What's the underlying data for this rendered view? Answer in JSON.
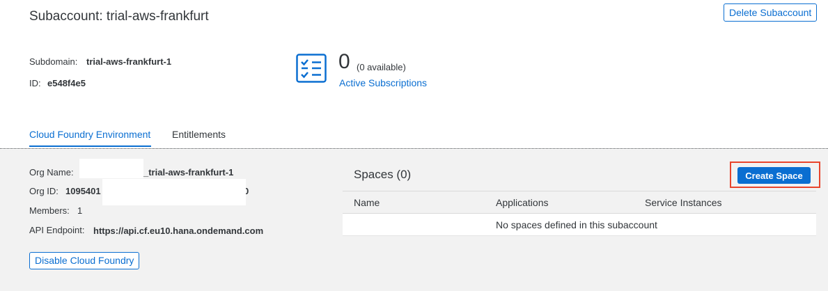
{
  "header": {
    "title": "Subaccount: trial-aws-frankfurt",
    "delete_label": "Delete Subaccount"
  },
  "info": {
    "subdomain_label": "Subdomain:",
    "subdomain_value": "trial-aws-frankfurt-1",
    "id_label": "ID:",
    "id_value": "e548f4e5"
  },
  "subscriptions": {
    "icon": "checklist-icon",
    "count": "0",
    "available": "(0 available)",
    "link_label": "Active Subscriptions"
  },
  "tabs": [
    {
      "label": "Cloud Foundry Environment",
      "active": true
    },
    {
      "label": "Entitlements",
      "active": false
    }
  ],
  "org": {
    "name_label": "Org Name:",
    "name_value": "_trial-aws-frankfurt-1",
    "id_label": "Org ID:",
    "id_value": "1095401",
    "id_suffix": "0",
    "members_label": "Members:",
    "members_value": "1",
    "api_label": "API Endpoint:",
    "api_value": "https://api.cf.eu10.hana.ondemand.com",
    "disable_label": "Disable Cloud Foundry"
  },
  "spaces": {
    "title": "Spaces (0)",
    "create_label": "Create Space",
    "columns": [
      "Name",
      "Applications",
      "Service Instances"
    ],
    "empty_text": "No spaces defined in this subaccount"
  },
  "colors": {
    "accent": "#0a6ed1",
    "highlight": "#e8442c",
    "panel_bg": "#f2f2f2",
    "text": "#32363a"
  }
}
